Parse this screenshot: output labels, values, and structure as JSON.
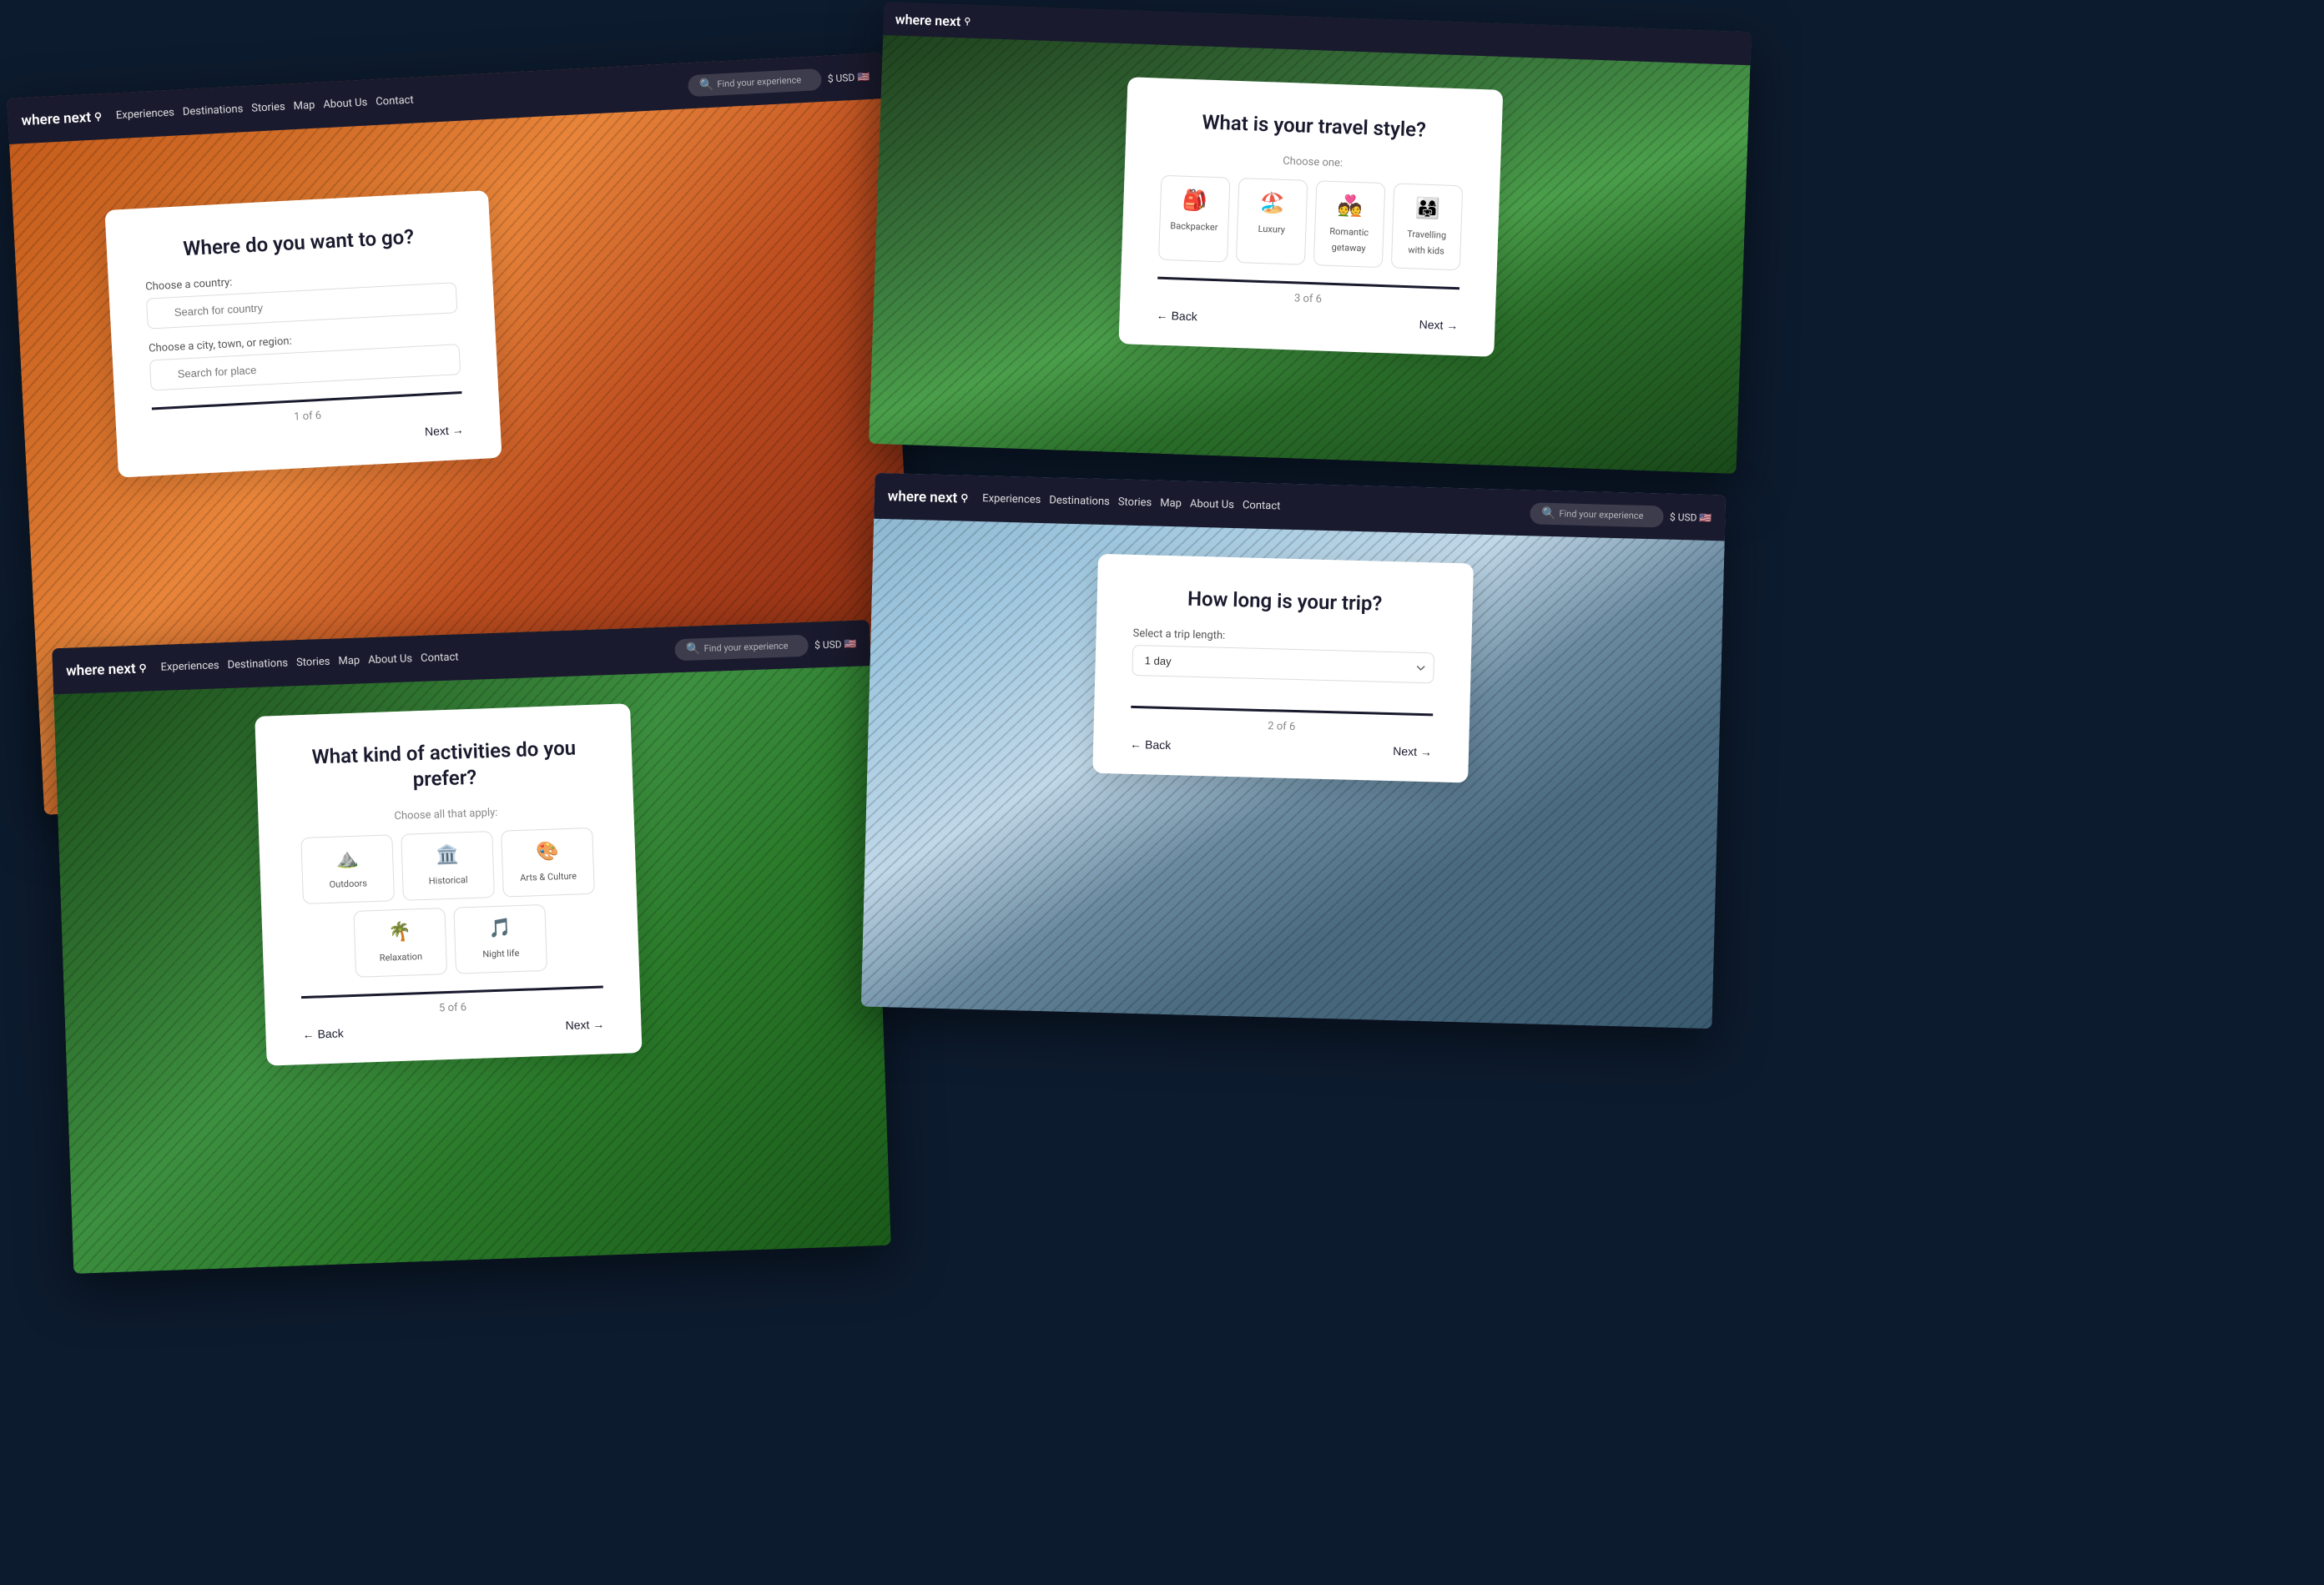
{
  "background": {
    "color": "#0d1b2e"
  },
  "screens": {
    "screen1": {
      "title": "Where do you want to go?",
      "country_label": "Choose a country:",
      "country_placeholder": "Search for country",
      "place_label": "Choose a city, town, or region:",
      "place_placeholder": "Search for place",
      "next_label": "Next",
      "progress": "1 of 6",
      "logo": "where next",
      "nav_items": [
        "Experiences",
        "Destinations",
        "Stories",
        "Map",
        "About Us",
        "Contact"
      ],
      "search_placeholder": "Find your experience",
      "currency": "$ USD"
    },
    "screen2": {
      "title": "What is your travel style?",
      "subtitle": "Choose one:",
      "cards": [
        "Backpacker",
        "Luxury",
        "Romantic getaway",
        "Travelling with kids"
      ],
      "next_label": "Next",
      "back_label": "Back",
      "progress": "3 of 6",
      "logo": "where next",
      "header_text": "where next"
    },
    "screen3": {
      "title": "What kind of activities do you prefer?",
      "subtitle": "Choose all that apply:",
      "cards": [
        "Outdoors",
        "Historical",
        "Arts & Culture",
        "Relaxation",
        "Night life"
      ],
      "next_label": "Next",
      "back_label": "Back",
      "progress": "5 of 6",
      "logo": "where next",
      "nav_items": [
        "Experiences",
        "Destinations",
        "Stories",
        "Map",
        "About Us",
        "Contact"
      ],
      "search_placeholder": "Find your experience",
      "currency": "$ USD"
    },
    "screen4": {
      "title": "How long is your trip?",
      "select_label": "Select a trip length:",
      "select_value": "1 day",
      "next_label": "Next",
      "back_label": "Back",
      "progress": "2 of 6",
      "logo": "where next",
      "nav_items": [
        "Experiences",
        "Destinations",
        "Stories",
        "Map",
        "About Us",
        "Contact"
      ],
      "search_placeholder": "Find your experience",
      "currency": "$ USD"
    }
  }
}
